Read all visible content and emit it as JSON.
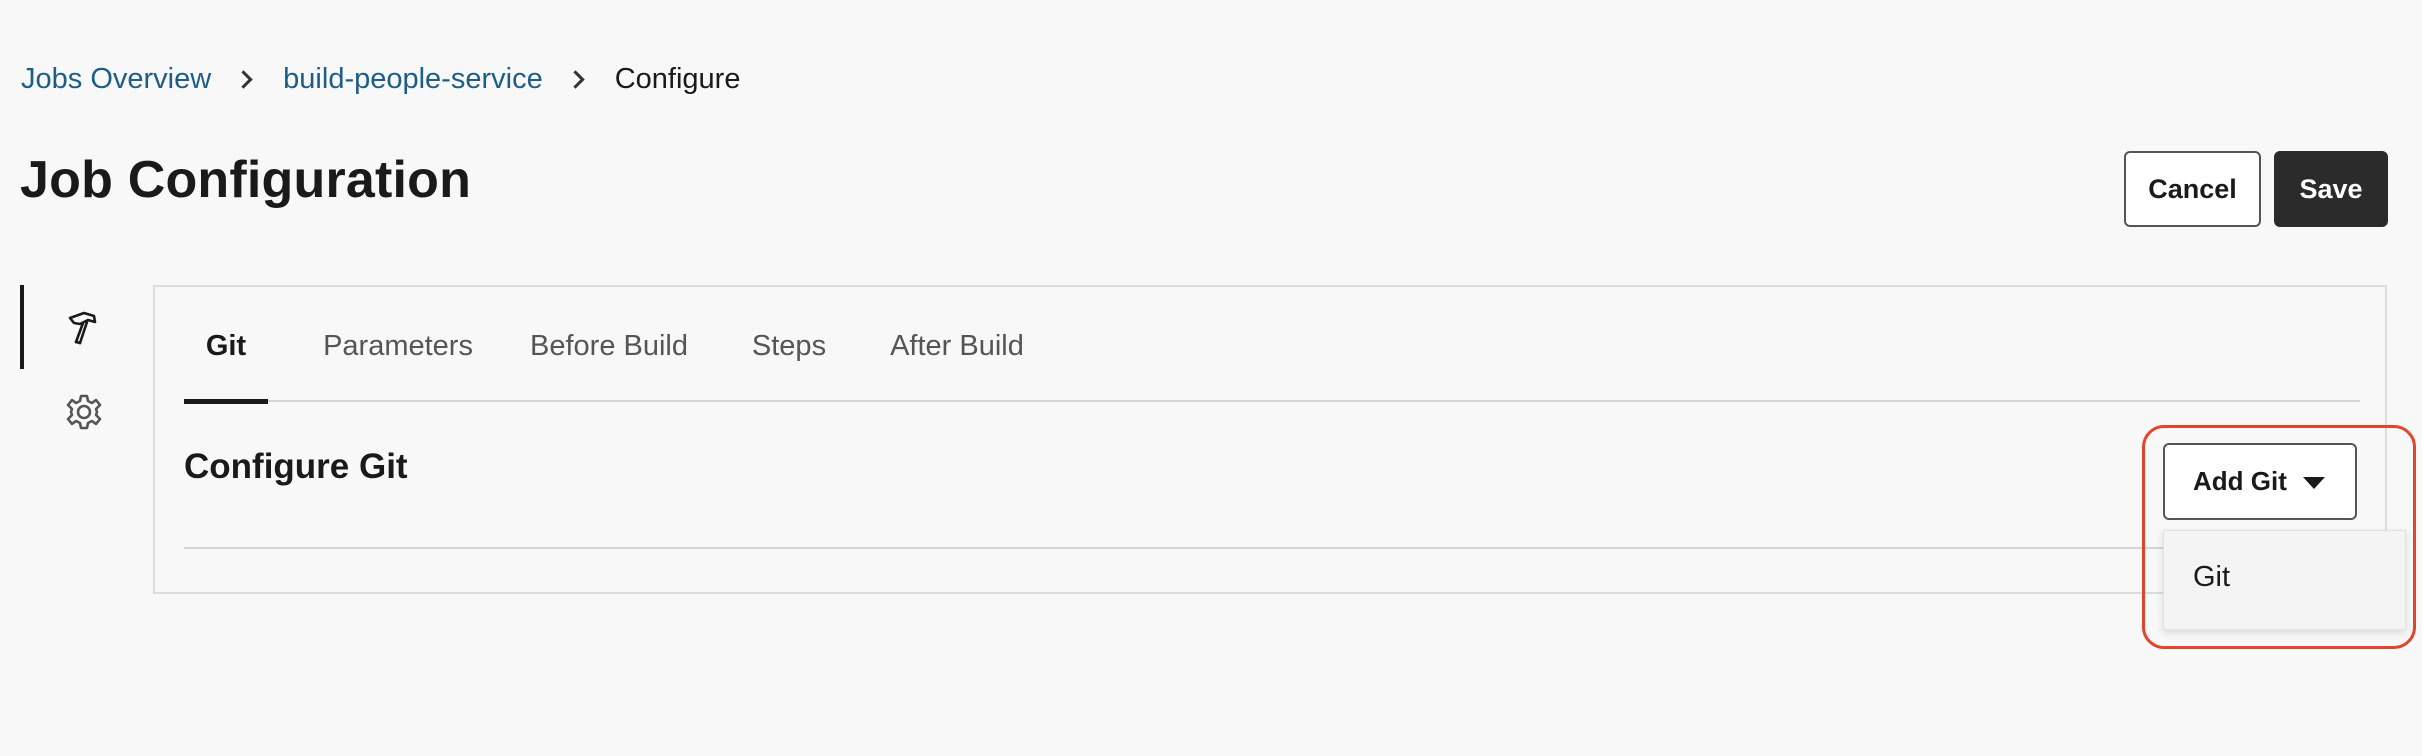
{
  "breadcrumb": {
    "items": [
      {
        "label": "Jobs Overview"
      },
      {
        "label": "build-people-service"
      },
      {
        "label": "Configure"
      }
    ]
  },
  "header": {
    "title": "Job Configuration",
    "cancel_label": "Cancel",
    "save_label": "Save"
  },
  "rail": {
    "icons": [
      "hammer-icon",
      "gear-icon"
    ]
  },
  "tabs": [
    {
      "label": "Git",
      "active": true
    },
    {
      "label": "Parameters",
      "active": false
    },
    {
      "label": "Before Build",
      "active": false
    },
    {
      "label": "Steps",
      "active": false
    },
    {
      "label": "After Build",
      "active": false
    }
  ],
  "section": {
    "title": "Configure Git"
  },
  "add_git": {
    "button_label": "Add Git",
    "menu_items": [
      {
        "label": "Git"
      }
    ]
  },
  "colors": {
    "link": "#1d5e87",
    "primary_button": "#2b2b2b",
    "highlight": "#e2452b",
    "background": "#f8f8f8"
  }
}
